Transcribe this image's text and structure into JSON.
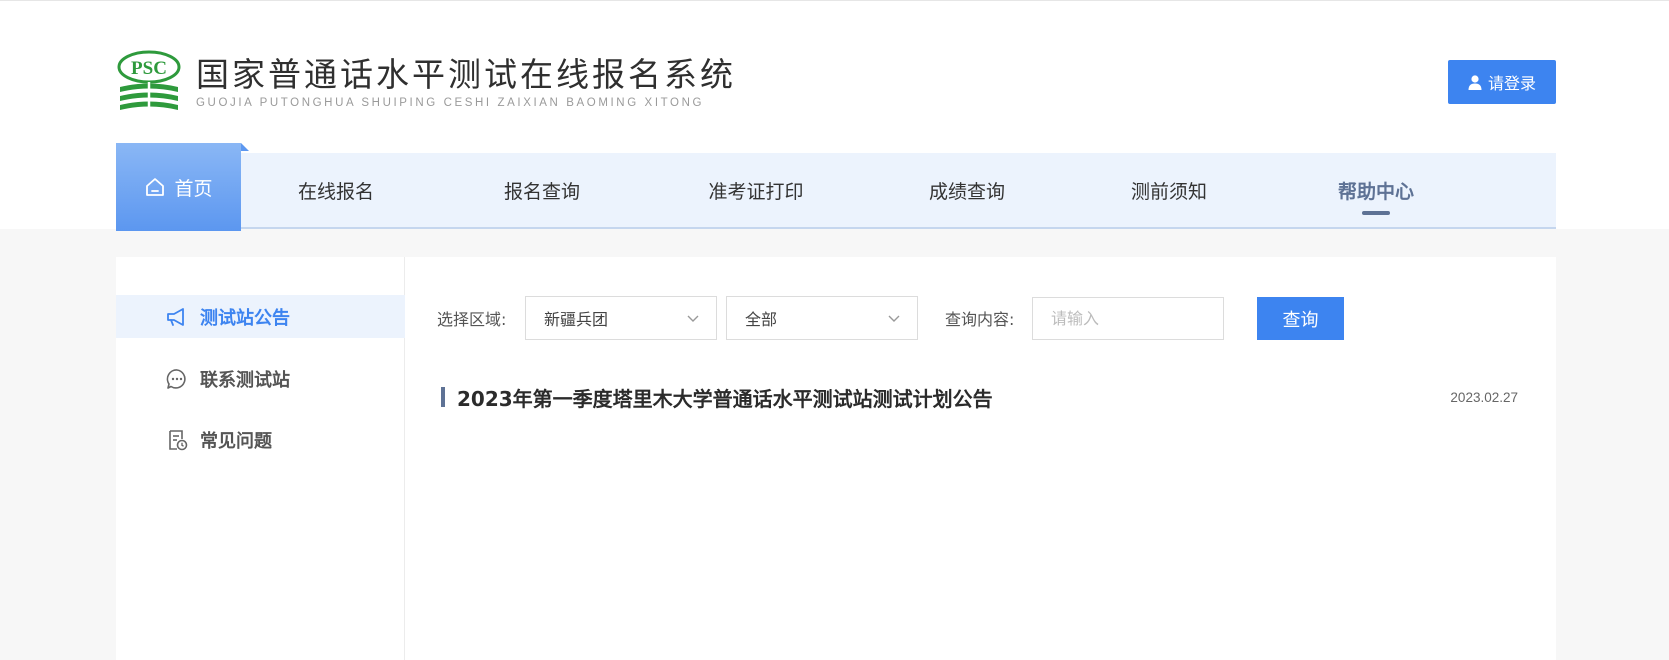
{
  "header": {
    "logo_text": "PSC",
    "title_cn": "国家普通话水平测试在线报名系统",
    "title_en": "GUOJIA PUTONGHUA SHUIPING CESHI ZAIXIAN BAOMING XITONG",
    "login_label": "请登录",
    "login_icon": "user-icon"
  },
  "nav": {
    "home": "首页",
    "items": [
      "在线报名",
      "报名查询",
      "准考证打印",
      "成绩查询",
      "测前须知",
      "帮助中心"
    ],
    "active": "帮助中心"
  },
  "sidebar": {
    "items": [
      {
        "label": "测试站公告",
        "icon": "megaphone-icon",
        "active": true
      },
      {
        "label": "联系测试站",
        "icon": "chat-icon",
        "active": false
      },
      {
        "label": "常见问题",
        "icon": "faq-document-icon",
        "active": false
      }
    ]
  },
  "filter": {
    "region_label": "选择区域:",
    "region_value": "新疆兵团",
    "sub_region_value": "全部",
    "query_label": "查询内容:",
    "query_placeholder": "请输入",
    "query_button": "查询"
  },
  "articles": [
    {
      "title": "2023年第一季度塔里木大学普通话水平测试站测试计划公告",
      "date": "2023.02.27"
    }
  ],
  "colors": {
    "accent": "#3d84f0",
    "nav_bg": "#ecf3fd",
    "nav_active": "#5e7295",
    "logo_green": "#2e9a3c"
  }
}
